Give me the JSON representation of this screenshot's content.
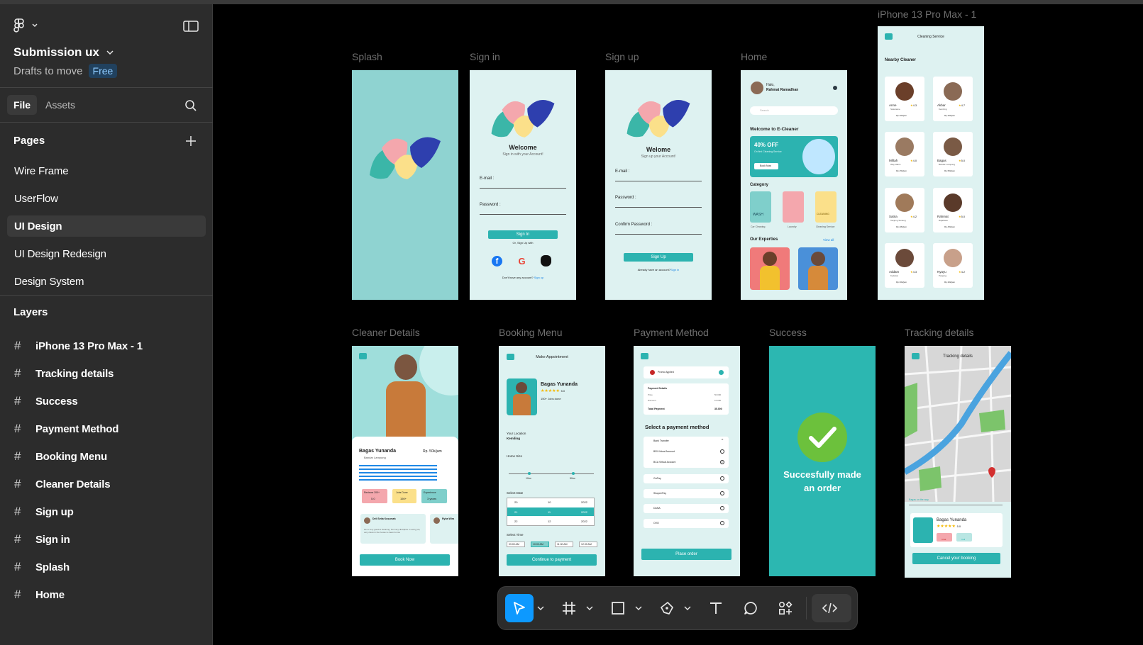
{
  "file": {
    "name": "Submission ux",
    "location": "Drafts to move",
    "plan_badge": "Free"
  },
  "panel_tabs": {
    "file": "File",
    "assets": "Assets"
  },
  "pages": {
    "header": "Pages",
    "items": [
      "Wire Frame",
      "UserFlow",
      "UI Design",
      "UI Design Redesign",
      "Design System"
    ],
    "selected": "UI Design"
  },
  "layers": {
    "header": "Layers",
    "items": [
      "iPhone 13 Pro Max - 1",
      "Tracking details",
      "Success",
      "Payment Method",
      "Booking Menu",
      "Cleaner Details",
      "Sign up",
      "Sign in",
      "Splash",
      "Home"
    ]
  },
  "frames": {
    "splash": {
      "label": "Splash"
    },
    "signin": {
      "label": "Sign in",
      "title": "Welcome",
      "subtitle": "Sign in with your Account!",
      "email": "E-mail :",
      "password": "Password :",
      "button": "Sign In",
      "or": "Or, Sign Up with",
      "footer": "Don't have any account?",
      "footer_link": "Sign up"
    },
    "signup": {
      "label": "Sign up",
      "title": "Welome",
      "subtitle": "Sign up your Account!",
      "email": "E-mail :",
      "password": "Password :",
      "confirm": "Confirm Password :",
      "button": "Sign Up",
      "footer": "Already have an account?",
      "footer_link": "Sign in"
    },
    "home": {
      "label": "Home",
      "greeting": "Halo,",
      "user": "Rahmat Ramadhan",
      "search": "Search",
      "welcome": "Welcome to E-Cleaner",
      "promo": "40% OFF",
      "promo_sub": "On first Cleaning Service",
      "promo_btn": "Book Now",
      "category": "Category",
      "categories": [
        "Car Cleaning",
        "Laundry",
        "Cleaning Service"
      ],
      "experties": "Our Experties",
      "view_all": "View all",
      "wash": "WASH",
      "cleaning": "CLEANING"
    },
    "iphone": {
      "label": "iPhone 13 Pro Max - 1",
      "title": "Cleaning Service",
      "nearby": "Nearby Cleaner",
      "cleaners": [
        {
          "name": "Anne",
          "rating": "4.3",
          "loc": "Sukarame",
          "price": "Rp.30k/jam"
        },
        {
          "name": "Akbar",
          "rating": "4.7",
          "loc": "Kemiling",
          "price": "Rp.40k/jam"
        },
        {
          "name": "Miftah",
          "rating": "4.0",
          "loc": "Way Halim",
          "price": "Rp.25k/jam"
        },
        {
          "name": "Bagas",
          "rating": "5.0",
          "loc": "Bandar Lampung",
          "price": "Rp.50k/jam"
        },
        {
          "name": "Satria",
          "rating": "4.2",
          "loc": "Tanjung Senang",
          "price": "Rp.28k/jam"
        },
        {
          "name": "Rahmat",
          "rating": "5.0",
          "loc": "Rajabasa",
          "price": "Rp.45k/jam"
        },
        {
          "name": "Addam",
          "rating": "4.3",
          "loc": "Kedaton",
          "price": "Rp.30k/jam"
        },
        {
          "name": "Nyayu",
          "rating": "4.2",
          "loc": "Panjang",
          "price": "Rp.32k/jam"
        }
      ]
    },
    "cleaner_details": {
      "label": "Cleaner Details",
      "name": "Bagas Yunanda",
      "price": "Rp. 50k/jam",
      "location": "Bandar Lampung",
      "stat1": "Reviews 200+",
      "stat1_val": "5.0",
      "stat2": "Jobs Done",
      "stat2_val": "150+",
      "stat3": "Experience",
      "stat3_val": "3 years",
      "reviewer1": "Deli Setia Kusumah",
      "reviewer2": "Ryba Wira",
      "review_text": "He is very good at cleaning. Not very discipline in every job, very clean in the house is clean & nice",
      "button": "Book Now"
    },
    "booking": {
      "label": "Booking Menu",
      "title": "Make Appointment",
      "name": "Bagas Yunanda",
      "rating": "5.0",
      "jobs": "150+ Jobs done",
      "location_label": "Your Location",
      "location": "Kemiling",
      "home_size": "Home Size",
      "min": "10m²",
      "max": "50m²",
      "select_date": "Select Date",
      "dates": [
        [
          "20",
          "10",
          "2022"
        ],
        [
          "21",
          "11",
          "2022"
        ],
        [
          "22",
          "12",
          "2022"
        ]
      ],
      "select_time": "Select Time",
      "times": [
        "09.00 AM",
        "10.00 AM",
        "11.00 AM",
        "12.00 AM"
      ],
      "button": "Continue to payment"
    },
    "payment": {
      "label": "Payment Method",
      "promo": "Promo Applied",
      "details": "Payment Details",
      "price": "Price",
      "price_val": "50.000",
      "discount": "Discount",
      "discount_val": "10.000",
      "total": "Total Payment",
      "total_val": "35.000",
      "heading": "Select a payment method",
      "bank": "Bank Transfer",
      "options": [
        "BRI Virtual Account",
        "BCA Virtual Account",
        "GoPay",
        "ShopeePay",
        "DANA",
        "OVO"
      ],
      "button": "Place order"
    },
    "success": {
      "label": "Success",
      "message_line1": "Succesfully made",
      "message_line2": "an order"
    },
    "tracking": {
      "label": "Tracking details",
      "title": "Tracking details",
      "status": "Bagas on the way",
      "name": "Bagas Yunanda",
      "rating": "5.0",
      "chat": "Chat",
      "call": "Call",
      "button": "Cancel your booking"
    }
  },
  "colors": {
    "teal": "#2cb3b0",
    "frame_bg": "#def2f1",
    "splash_bg": "#8fd3d1",
    "success_bg": "#2cb7b1",
    "check_green": "#6cc13c",
    "accent_blue": "#1e88e5",
    "logo_pink": "#f4a7ad",
    "logo_yellow": "#fbe08a",
    "logo_navy": "#2e3fae",
    "logo_teal": "#3bb6a8"
  }
}
